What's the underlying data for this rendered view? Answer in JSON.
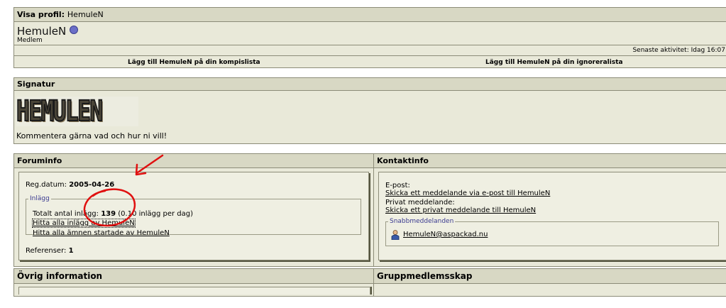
{
  "profile": {
    "header_label": "Visa profil",
    "username": "HemuleN",
    "rank": "Medlem",
    "last_activity": "Senaste aktivitet: Idag 16:07"
  },
  "actions": {
    "add_buddy": "Lägg till HemuleN på din kompislista",
    "add_ignore": "Lägg till HemuleN på din ignoreralista"
  },
  "signature": {
    "header": "Signatur",
    "image_text": "HEMULEN",
    "text": "Kommentera gärna vad och hur ni vill!"
  },
  "forum_info": {
    "header": "Foruminfo",
    "reg_label": "Reg.datum:",
    "reg_date": "2005-04-26",
    "posts_legend": "Inlägg",
    "total_label": "Totalt antal inlägg:",
    "total_posts": "139",
    "per_day": "(0.10 inlägg per dag)",
    "find_posts_link": "Hitta alla inlägg av HemuleN",
    "find_threads_link": "Hitta alla ämnen startade av HemuleN",
    "references_label": "Referenser:",
    "references": "1"
  },
  "contact_info": {
    "header": "Kontaktinfo",
    "email_label": "E-post:",
    "email_link": "Skicka ett meddelande via e-post till HemuleN",
    "pm_label": "Privat meddelande:",
    "pm_link": "Skicka ett privat meddelande till HemuleN",
    "im_legend": "Snabbmeddelanden",
    "im_account": "HemuleN@aspackad.nu"
  },
  "other_info": {
    "header": "Övrig information"
  },
  "groups": {
    "header": "Gruppmedlemsskap"
  },
  "colors": {
    "panel_bg": "#e9e9d9",
    "header_bg": "#d8d8c4",
    "annotation_red": "#e01010"
  },
  "icons": {
    "online_status": "status-dot-icon",
    "im_user": "user-icon",
    "annotation": "red-arrow-and-circle"
  }
}
